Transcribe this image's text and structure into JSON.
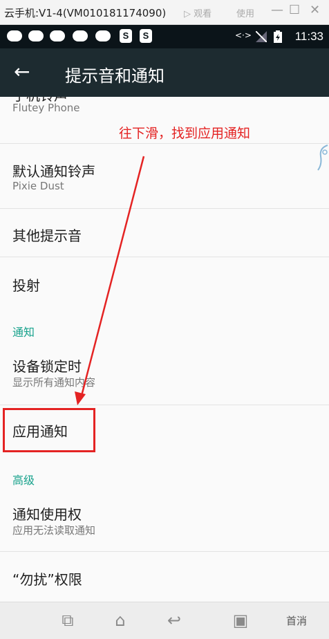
{
  "window": {
    "title": "云手机:V1-4(VM010181174090)",
    "watch_label": "▷ 观看",
    "use_label": "使用",
    "minimize": "—",
    "maximize": "☐",
    "close": "✕"
  },
  "statusbar": {
    "time": "11:33",
    "s1": "S",
    "s2": "S",
    "data_indicator": "<·>"
  },
  "appbar": {
    "back": "←",
    "title": "提示音和通知"
  },
  "settings": {
    "phone_ringtone": {
      "title": "手机铃声",
      "summary": "Flutey Phone"
    },
    "default_notification": {
      "title": "默认通知铃声",
      "summary": "Pixie Dust"
    },
    "other_sounds": {
      "title": "其他提示音"
    },
    "cast": {
      "title": "投射"
    },
    "section_notifications": "通知",
    "lock_screen": {
      "title": "设备锁定时",
      "summary": "显示所有通知内容"
    },
    "app_notifications": {
      "title": "应用通知"
    },
    "section_advanced": "高级",
    "notification_access": {
      "title": "通知使用权",
      "summary": "应用无法读取通知"
    },
    "dnd_access": {
      "title": "“勿扰”权限"
    }
  },
  "annotation": {
    "text": "往下滑，找到应用通知",
    "color": "#e42323"
  },
  "navbar": {
    "recent": "⧉",
    "home": "⌂",
    "back": "↩",
    "multi": "▣",
    "watermark": "首消"
  },
  "colors": {
    "appbar": "#1d2b30",
    "statusbar": "#0b1419",
    "accent": "#16a18b"
  }
}
